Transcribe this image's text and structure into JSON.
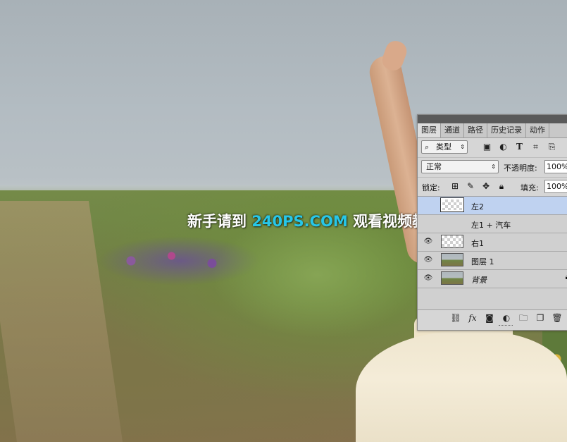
{
  "watermark": {
    "part1": "新手请到 ",
    "part2": "240PS.COM",
    "part3": " 观看视频教程",
    "accent_color": "#27c7e8"
  },
  "layers_panel": {
    "tabs": [
      "图层",
      "通道",
      "路径",
      "历史记录",
      "动作"
    ],
    "active_tab": "图层",
    "filter": {
      "label": "类型",
      "icons": [
        "image-filter-icon",
        "adjustment-filter-icon",
        "type-filter-icon",
        "shape-filter-icon",
        "smart-object-filter-icon"
      ]
    },
    "blend_mode": "正常",
    "opacity_label": "不透明度:",
    "opacity_value": "100%",
    "lock_label": "锁定:",
    "lock_icons": [
      "lock-transparent-icon",
      "lock-paint-icon",
      "lock-move-icon",
      "lock-all-icon"
    ],
    "fill_label": "填充:",
    "fill_value": "100%",
    "layers": [
      {
        "name": "左2",
        "visible": false,
        "selected": true,
        "thumb": "transparent"
      },
      {
        "name": "左1 + 汽车",
        "visible": false,
        "selected": false,
        "thumb": "none"
      },
      {
        "name": "右1",
        "visible": true,
        "selected": false,
        "thumb": "transparent"
      },
      {
        "name": "图层 1",
        "visible": true,
        "selected": false,
        "thumb": "photo"
      },
      {
        "name": "背景",
        "visible": true,
        "selected": false,
        "thumb": "photo",
        "locked": true
      }
    ],
    "bottom_icons": [
      "link-icon",
      "fx-icon",
      "mask-icon",
      "adjustment-layer-icon",
      "group-folder-icon",
      "new-layer-icon",
      "trash-icon"
    ],
    "fx_label": "fx"
  }
}
